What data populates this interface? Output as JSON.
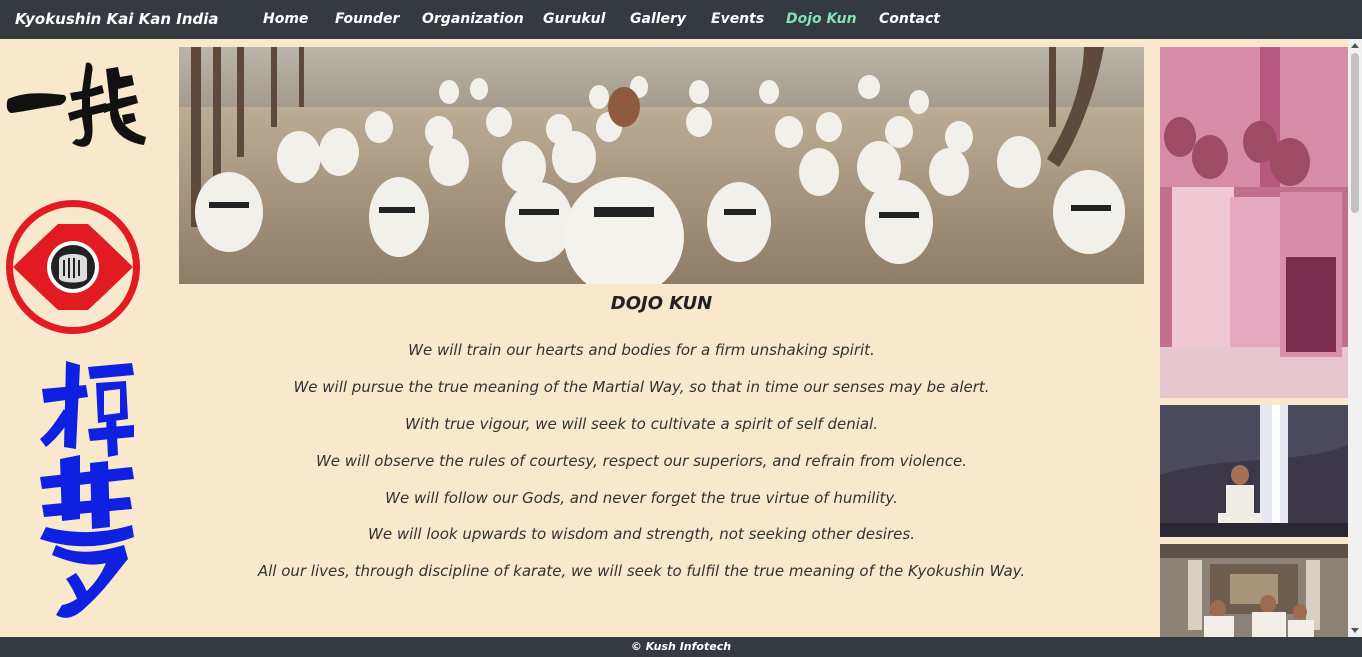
{
  "navbar": {
    "brand": "Kyokushin Kai Kan India",
    "items": [
      {
        "label": "Home"
      },
      {
        "label": "Founder"
      },
      {
        "label": "Organization"
      },
      {
        "label": "Gurukul"
      },
      {
        "label": "Gallery"
      },
      {
        "label": "Events"
      },
      {
        "label": "Dojo Kun",
        "active": true
      },
      {
        "label": "Contact"
      }
    ],
    "active_color": "#7ee4b6",
    "background": "#343a40"
  },
  "left_column": {
    "icons": [
      "ichigeki-calligraphy-icon",
      "kanku-emblem-icon",
      "kyokushin-kanji-icon"
    ]
  },
  "main": {
    "banner": "dojo-training-group-photo",
    "title": "DOJO KUN",
    "lines": [
      "We will train our hearts and bodies for a firm unshaking spirit.",
      "We will pursue the true meaning of the Martial Way, so that in time our senses may be alert.",
      "With true vigour, we will seek to cultivate a spirit of self denial.",
      "We will observe the rules of courtesy, respect our superiors, and refrain from violence.",
      "We will follow our Gods, and never forget the true virtue of humility.",
      "We will look upwards to wisdom and strength, not seeking other desires.",
      "All our lives, through discipline of karate, we will seek to fulfil the true meaning of the Kyokushin Way."
    ]
  },
  "right_column": {
    "photos": [
      "group-portrait-photo",
      "waterfall-training-photo",
      "dojo-shrine-photo"
    ]
  },
  "footer": {
    "text": "© Kush Infotech"
  },
  "colors": {
    "page_background": "#f8e8cc",
    "kanku_red": "#e21b23",
    "kanji_blue": "#1020e0"
  }
}
